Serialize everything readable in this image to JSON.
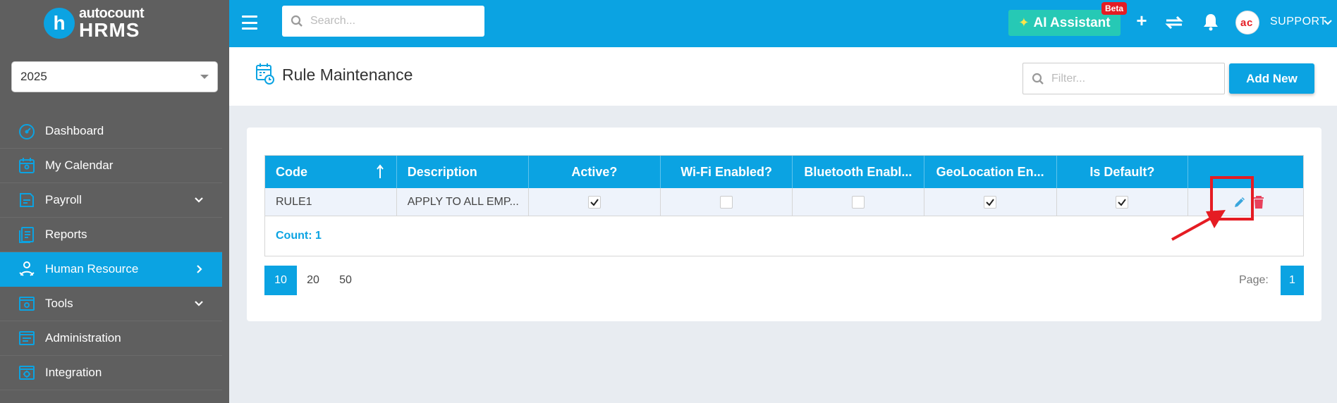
{
  "brand": {
    "line1": "autocount",
    "line2": "HRMS",
    "logo_letter": "h"
  },
  "year_select": {
    "value": "2025"
  },
  "sidebar": {
    "items": [
      {
        "label": "Dashboard",
        "icon": "dashboard-gauge-icon",
        "has_chevron": false
      },
      {
        "label": "My Calendar",
        "icon": "calendar-user-icon",
        "has_chevron": false
      },
      {
        "label": "Payroll",
        "icon": "payroll-icon",
        "has_chevron": true
      },
      {
        "label": "Reports",
        "icon": "reports-icon",
        "has_chevron": false
      },
      {
        "label": "Human Resource",
        "icon": "human-resource-icon",
        "has_chevron": true,
        "active": true
      },
      {
        "label": "Tools",
        "icon": "tools-icon",
        "has_chevron": true
      },
      {
        "label": "Administration",
        "icon": "administration-icon",
        "has_chevron": false
      },
      {
        "label": "Integration",
        "icon": "integration-icon",
        "has_chevron": false
      }
    ]
  },
  "topbar": {
    "search_placeholder": "Search...",
    "ai_label": "AI Assistant",
    "beta_label": "Beta",
    "plus_label": "+",
    "user_name": "SUPPORT"
  },
  "page": {
    "title": "Rule Maintenance",
    "filter_placeholder": "Filter...",
    "add_new_label": "Add New"
  },
  "grid": {
    "columns": [
      "Code",
      "Description",
      "Active?",
      "Wi-Fi Enabled?",
      "Bluetooth Enabl...",
      "GeoLocation En...",
      "Is Default?",
      ""
    ],
    "rows": [
      {
        "code": "RULE1",
        "description": "APPLY TO ALL EMP...",
        "active": true,
        "wifi": false,
        "bluetooth": false,
        "geolocation": true,
        "is_default": true
      }
    ],
    "count_label": "Count: 1"
  },
  "pager": {
    "sizes": [
      "10",
      "20",
      "50"
    ],
    "selected_size": "10",
    "page_label": "Page:",
    "current_page": "1"
  },
  "colors": {
    "accent": "#0ba3e2",
    "sidebar": "#5f5f5f",
    "ai": "#26c9b5",
    "annotation": "#e51c23",
    "delete": "#e8415c"
  }
}
